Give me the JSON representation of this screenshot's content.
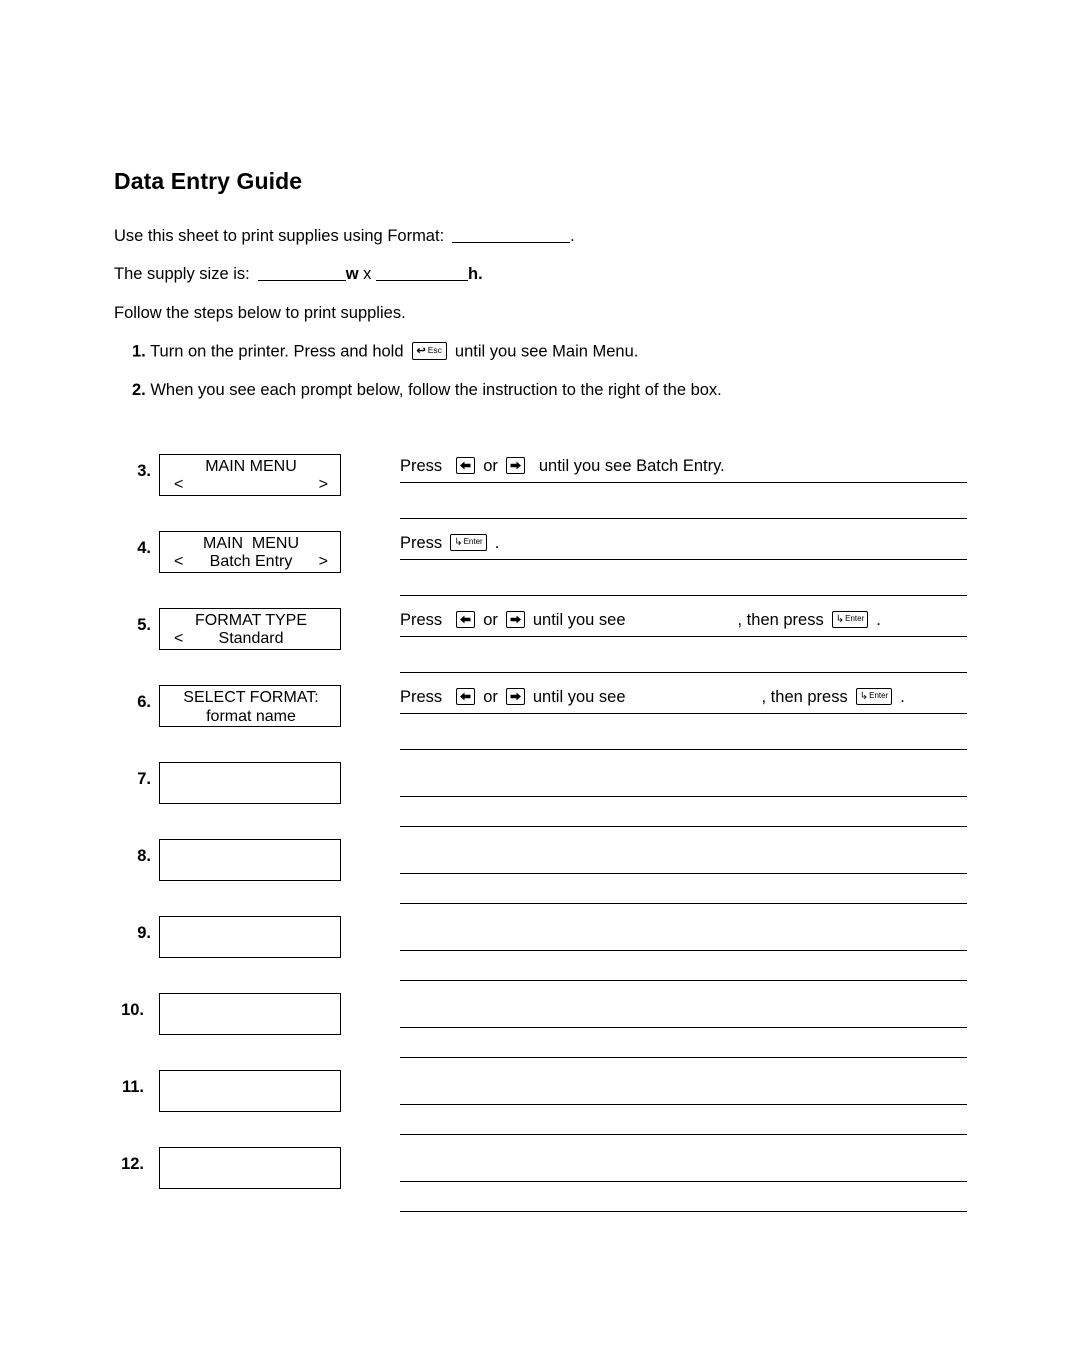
{
  "document": {
    "title": "Data Entry Guide",
    "intro": {
      "format_prefix": "Use this sheet to print supplies using Format:",
      "format_suffix": ".",
      "size_prefix": "The supply size is:",
      "size_w": "w",
      "size_x": "x",
      "size_h": "h.",
      "follow": "Follow the steps below to print supplies."
    },
    "numbered_steps": [
      {
        "number": "1.",
        "text_before_key": "Turn on the printer.  Press and hold",
        "key": "esc-key",
        "key_symbol": "↩",
        "key_label": "Esc",
        "text_after_key": "until you see Main Menu."
      },
      {
        "number": "2.",
        "text_before_key": "When you see each prompt below, follow the instruction to the right of the box.",
        "key": "",
        "key_symbol": "",
        "key_label": "",
        "text_after_key": ""
      }
    ],
    "keys": {
      "left_arrow": {
        "name": "left-arrow-key",
        "symbol": "←"
      },
      "right_arrow": {
        "name": "right-arrow-key",
        "symbol": "→"
      },
      "enter": {
        "name": "enter-key",
        "symbol": "↳",
        "label": "Enter"
      },
      "esc": {
        "name": "esc-key",
        "symbol": "↩",
        "label": "Esc"
      }
    },
    "prompt_rows": [
      {
        "number": "3.",
        "display": {
          "line1": "MAIN MENU",
          "line2_left": "<",
          "line2_mid": "",
          "line2_right": ">"
        },
        "instruction": {
          "press": "Press",
          "or": "or",
          "middle": "until you see Batch Entry.",
          "then_press": "",
          "period": "",
          "blank_after_middle": false,
          "has_enter_at_end": false
        }
      },
      {
        "number": "4.",
        "display": {
          "line1": "MAIN  MENU",
          "line2_left": "<",
          "line2_mid": "Batch Entry",
          "line2_right": ">"
        },
        "instruction": {
          "press": "Press",
          "or": "",
          "middle": "",
          "then_press": "",
          "period": ".",
          "blank_after_middle": false,
          "has_enter_at_end": false
        }
      },
      {
        "number": "5.",
        "display": {
          "line1": "FORMAT TYPE",
          "line2_left": "<",
          "line2_mid": "Standard",
          "line2_right": ""
        },
        "instruction": {
          "press": "Press",
          "or": "or",
          "middle": "until you see",
          "then_press": ", then press",
          "period": ".",
          "blank_after_middle": true,
          "has_enter_at_end": true
        }
      },
      {
        "number": "6.",
        "display": {
          "line1": "SELECT FORMAT:",
          "line2_left": "",
          "line2_mid": "format name",
          "line2_right": ""
        },
        "instruction": {
          "press": "Press",
          "or": "or",
          "middle": "until you see",
          "then_press": ", then press",
          "period": ".",
          "blank_after_middle": true,
          "has_enter_at_end": true
        }
      },
      {
        "number": "7.",
        "display": null,
        "instruction": null
      },
      {
        "number": "8.",
        "display": null,
        "instruction": null
      },
      {
        "number": "9.",
        "display": null,
        "instruction": null
      },
      {
        "number": "10.",
        "display": null,
        "instruction": null
      },
      {
        "number": "11.",
        "display": null,
        "instruction": null
      },
      {
        "number": "12.",
        "display": null,
        "instruction": null
      }
    ]
  }
}
